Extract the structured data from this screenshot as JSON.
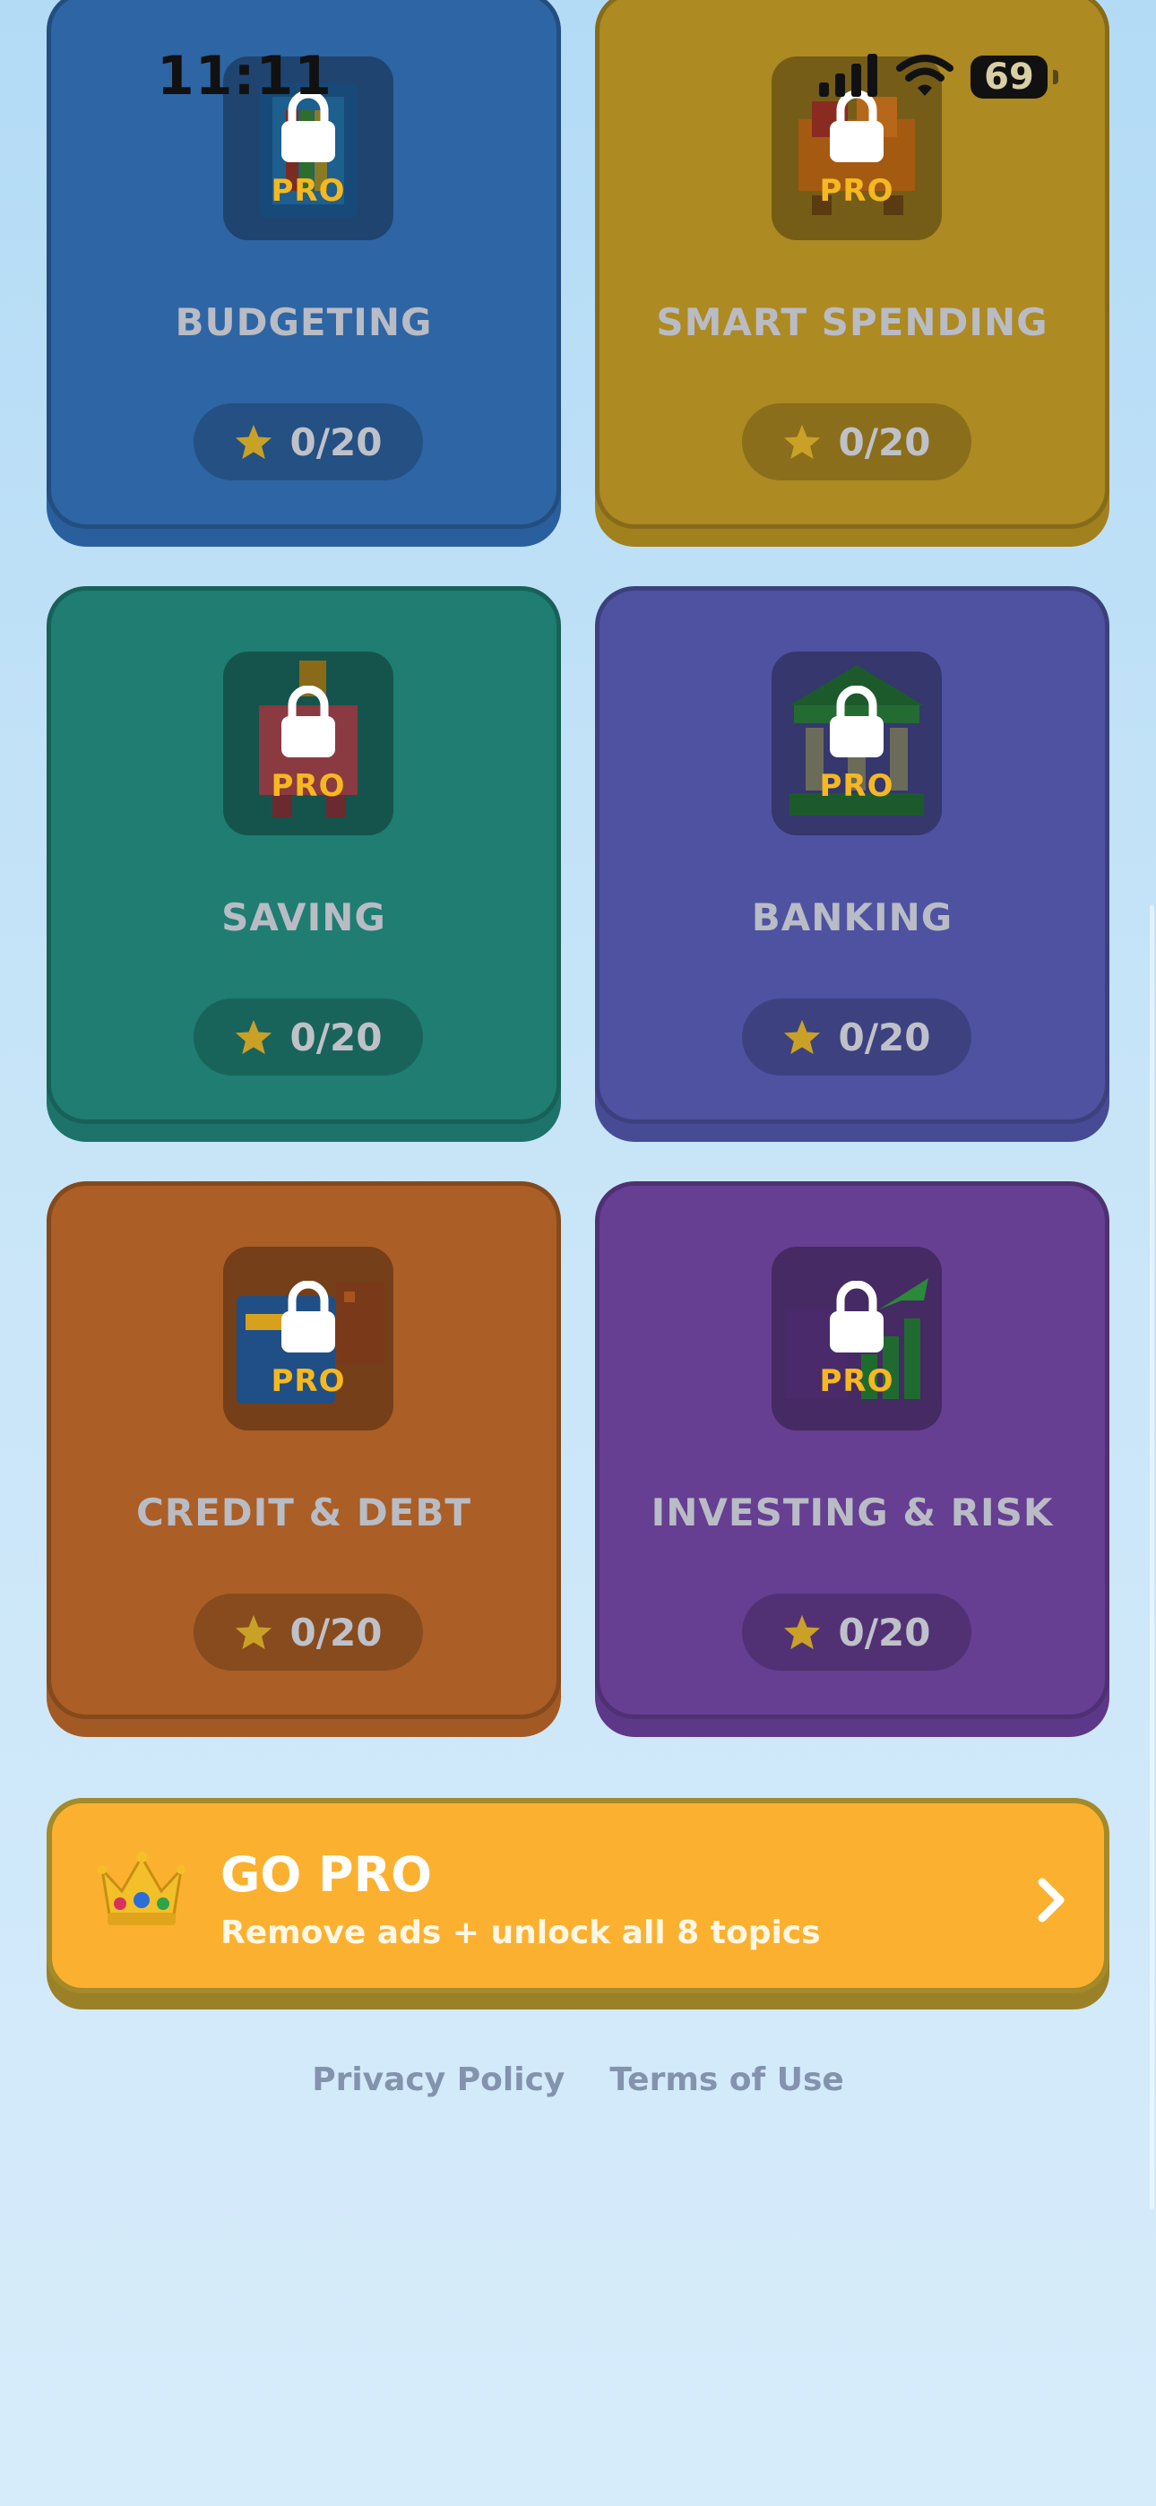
{
  "status_bar": {
    "time": "11:11",
    "battery": "69"
  },
  "topics": [
    {
      "title": "BUDGETING",
      "badge": "PRO",
      "score": "0/20",
      "icon": "ledger-book-icon"
    },
    {
      "title": "SMART SPENDING",
      "badge": "PRO",
      "score": "0/20",
      "icon": "shopping-cart-icon"
    },
    {
      "title": "SAVING",
      "badge": "PRO",
      "score": "0/20",
      "icon": "piggy-bank-icon"
    },
    {
      "title": "BANKING",
      "badge": "PRO",
      "score": "0/20",
      "icon": "bank-building-icon"
    },
    {
      "title": "CREDIT & DEBT",
      "badge": "PRO",
      "score": "0/20",
      "icon": "credit-card-icon"
    },
    {
      "title": "INVESTING & RISK",
      "badge": "PRO",
      "score": "0/20",
      "icon": "stock-chart-icon"
    }
  ],
  "go_pro": {
    "title": "GO PRO",
    "subtitle": "Remove ads + unlock all 8 topics",
    "icon": "crown-icon"
  },
  "footer": {
    "privacy": "Privacy Policy",
    "terms": "Terms of Use"
  },
  "colors": {
    "budgeting": "#2e65a4",
    "smart_spending": "#ad8a22",
    "saving": "#1f7d72",
    "banking": "#4e52a1",
    "credit_debt": "#ab5e25",
    "investing_risk": "#663e92",
    "go_pro": "#fbb12f",
    "pro_badge": "#f5b820"
  }
}
